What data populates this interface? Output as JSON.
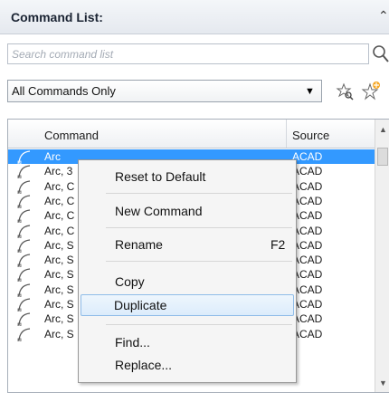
{
  "panel": {
    "title": "Command List:",
    "collapse_icon": "double-chevron-up-icon"
  },
  "search": {
    "placeholder": "Search command list",
    "value": "",
    "icon": "magnifier-icon"
  },
  "filter": {
    "selected": "All Commands Only",
    "icons": [
      "find-command-icon",
      "new-command-icon"
    ]
  },
  "list": {
    "columns": [
      "Command",
      "Source"
    ],
    "rows": [
      {
        "name": "Arc",
        "source": "ACAD",
        "selected": true
      },
      {
        "name": "Arc, 3",
        "source": "ACAD"
      },
      {
        "name": "Arc, C",
        "source": "ACAD"
      },
      {
        "name": "Arc, C",
        "source": "ACAD"
      },
      {
        "name": "Arc, C",
        "source": "ACAD"
      },
      {
        "name": "Arc, C",
        "source": "ACAD"
      },
      {
        "name": "Arc, S",
        "source": "ACAD"
      },
      {
        "name": "Arc, S",
        "source": "ACAD"
      },
      {
        "name": "Arc, S",
        "source": "ACAD"
      },
      {
        "name": "Arc, S",
        "source": "ACAD"
      },
      {
        "name": "Arc, S",
        "source": "ACAD"
      },
      {
        "name": "Arc, S",
        "source": "ACAD"
      },
      {
        "name": "Arc, S",
        "source": "ACAD"
      }
    ]
  },
  "context_menu": {
    "items": [
      {
        "label": "Reset to Default",
        "shortcut": ""
      },
      {
        "label": "New Command",
        "shortcut": ""
      },
      {
        "label": "Rename",
        "shortcut": "F2"
      },
      {
        "label": "Copy",
        "shortcut": ""
      },
      {
        "label": "Duplicate",
        "shortcut": "",
        "hover": true
      },
      {
        "label": "Find...",
        "shortcut": ""
      },
      {
        "label": "Replace...",
        "shortcut": ""
      }
    ]
  },
  "colors": {
    "selection": "#3399ff",
    "menu_hover_border": "#8fbce8"
  }
}
